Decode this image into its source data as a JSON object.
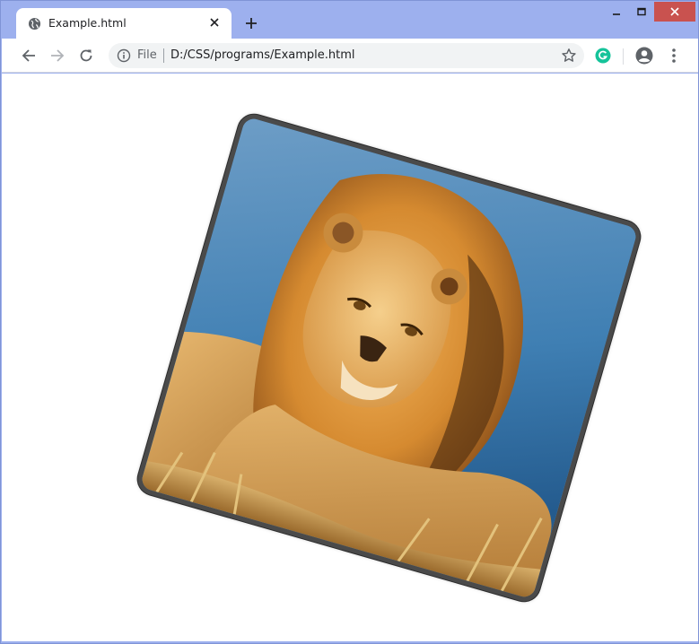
{
  "browser": {
    "tab": {
      "title": "Example.html",
      "favicon": "globe-icon"
    },
    "new_tab_icon": "plus-icon",
    "window_controls": [
      "minimize-icon",
      "maximize-icon",
      "close-icon"
    ],
    "address_bar": {
      "scheme_label": "File",
      "url": "D:/CSS/programs/Example.html"
    },
    "extensions": [
      "grammarly-icon"
    ],
    "colors": {
      "titlebar": "#9db0ee",
      "close_button": "#c9524f",
      "grammarly": "#15c39a"
    }
  },
  "page": {
    "image": {
      "subject": "lion",
      "rotation_deg": 16,
      "border_color": "#4a4a4a"
    }
  }
}
